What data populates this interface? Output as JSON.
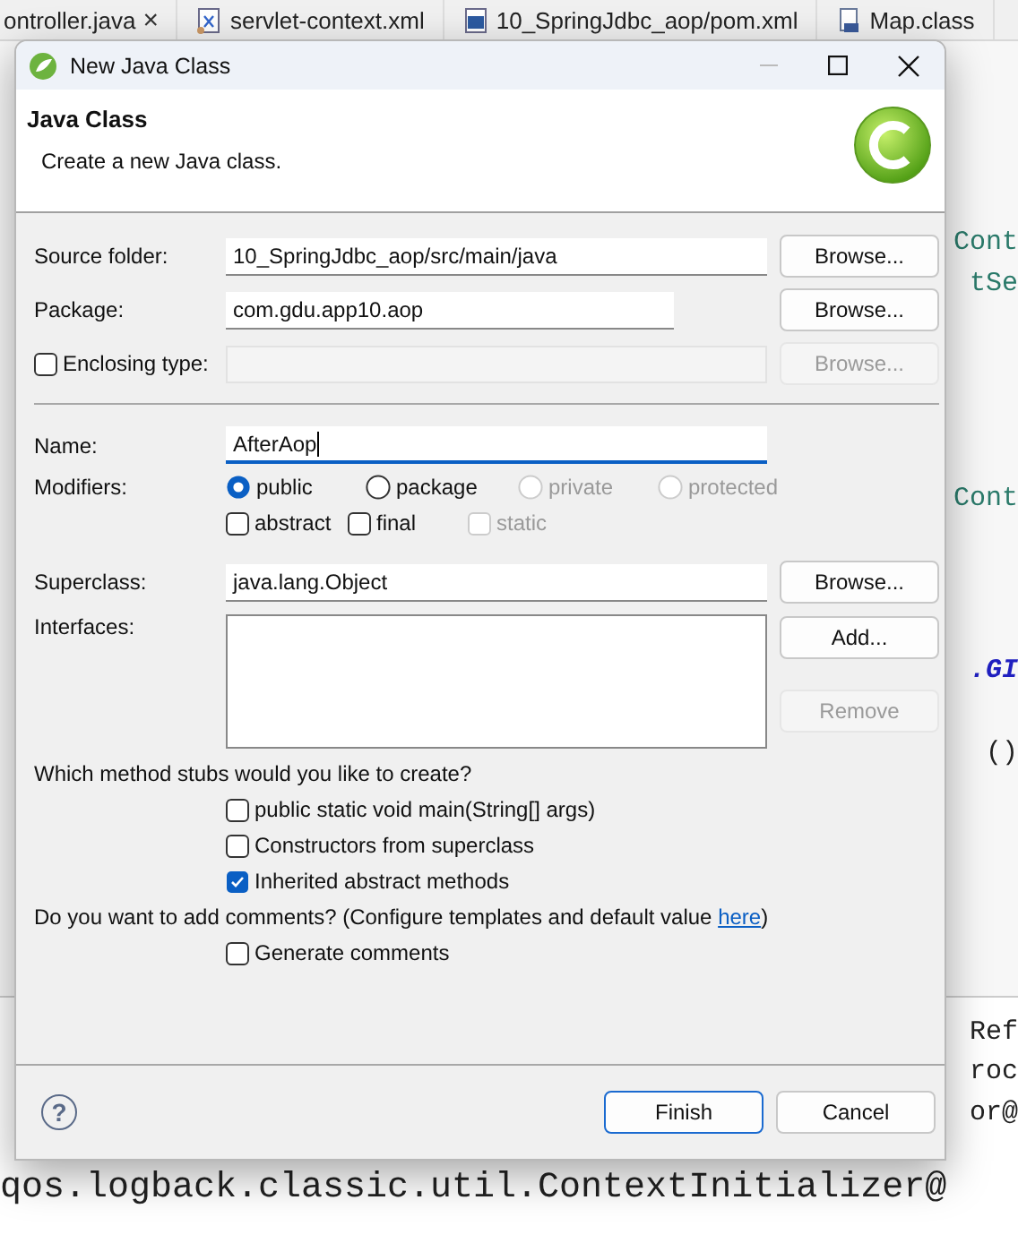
{
  "editor": {
    "tabs": [
      {
        "label": "ontroller.java",
        "kind": "java",
        "close": "×"
      },
      {
        "label": "servlet-context.xml",
        "kind": "xml"
      },
      {
        "label": "10_SpringJdbc_aop/pom.xml",
        "kind": "maven"
      },
      {
        "label": "Map.class",
        "kind": "class"
      }
    ],
    "right_fragments": [
      "Cont",
      "tSe",
      "Cont",
      ".GI",
      "()",
      "Ref",
      "roc",
      "or@"
    ],
    "console_line": "qos.logback.classic.util.ContextInitializer@"
  },
  "dialog": {
    "title": "New Java Class",
    "heading": "Java Class",
    "description": "Create a new Java class.",
    "source_folder": {
      "label": "Source folder:",
      "value": "10_SpringJdbc_aop/src/main/java",
      "button": "Browse..."
    },
    "package": {
      "label": "Package:",
      "value": "com.gdu.app10.aop",
      "button": "Browse..."
    },
    "enclosing_type": {
      "label": "Enclosing type:",
      "checked": false,
      "button": "Browse...",
      "disabled": true
    },
    "name": {
      "label": "Name:",
      "value": "AfterAop",
      "focused": true
    },
    "modifiers": {
      "label": "Modifiers:",
      "access": [
        {
          "label": "public",
          "selected": true,
          "disabled": false
        },
        {
          "label": "package",
          "selected": false,
          "disabled": false
        },
        {
          "label": "private",
          "selected": false,
          "disabled": true
        },
        {
          "label": "protected",
          "selected": false,
          "disabled": true
        }
      ],
      "flags": [
        {
          "label": "abstract",
          "checked": false,
          "disabled": false
        },
        {
          "label": "final",
          "checked": false,
          "disabled": false
        },
        {
          "label": "static",
          "checked": false,
          "disabled": true
        }
      ]
    },
    "superclass": {
      "label": "Superclass:",
      "value": "java.lang.Object",
      "button": "Browse..."
    },
    "interfaces": {
      "label": "Interfaces:",
      "add_button": "Add...",
      "remove_button": {
        "label": "Remove",
        "disabled": true
      }
    },
    "stubs": {
      "question": "Which method stubs would you like to create?",
      "options": [
        {
          "label": "public static void main(String[] args)",
          "checked": false
        },
        {
          "label": "Constructors from superclass",
          "checked": false
        },
        {
          "label": "Inherited abstract methods",
          "checked": true
        }
      ]
    },
    "comments": {
      "question": "Do you want to add comments? (Configure templates and default value",
      "link": "here",
      "closing": ")",
      "option": {
        "label": "Generate comments",
        "checked": false
      }
    },
    "help": "?",
    "buttons": {
      "finish": "Finish",
      "cancel": "Cancel"
    }
  }
}
